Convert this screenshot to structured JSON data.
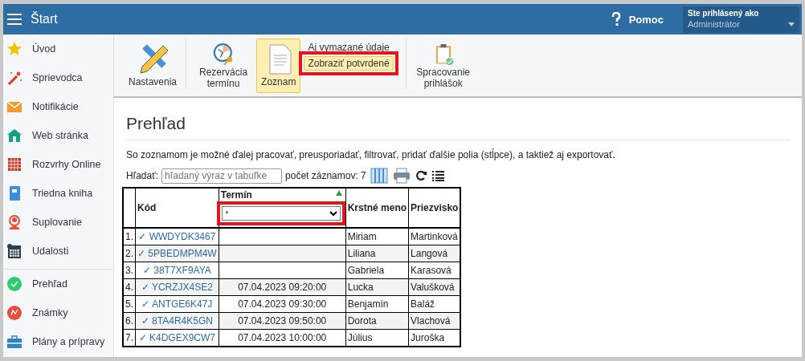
{
  "topbar": {
    "title": "Štart",
    "help": "Pomoc",
    "user_label": "Ste prihlásený ako",
    "user_name": "Administrátor"
  },
  "sidebar": {
    "groups": [
      [
        {
          "label": "Úvod"
        },
        {
          "label": "Sprievodca"
        },
        {
          "label": "Notifikácie"
        },
        {
          "label": "Web stránka"
        },
        {
          "label": "Rozvrhy Online"
        },
        {
          "label": "Triedna kniha"
        },
        {
          "label": "Suplovanie"
        },
        {
          "label": "Udalosti"
        }
      ],
      [
        {
          "label": "Prehľad"
        },
        {
          "label": "Známky"
        },
        {
          "label": "Plány a prípravy"
        }
      ]
    ]
  },
  "ribbon": {
    "items": [
      {
        "kind": "button",
        "label": "Nastavenia",
        "selected": false
      },
      {
        "kind": "button",
        "label": "Rezervácia termínu",
        "selected": false
      },
      {
        "kind": "button",
        "label": "Zoznam",
        "selected": true
      },
      {
        "kind": "options",
        "options": [
          {
            "label": "Aj vymazané údaje",
            "selected": false,
            "highlighted": false
          },
          {
            "label": "Zobraziť potvrdené",
            "selected": true,
            "highlighted": true
          }
        ]
      },
      {
        "kind": "button",
        "label": "Spracovanie prihlášok",
        "selected": false
      }
    ]
  },
  "page": {
    "title": "Prehľad",
    "description": "So zoznamom je možné ďalej pracovať, preusporiadať, filtrovať, pridať ďalšie polia (stĺpce), a taktiež aj exportovať.",
    "search_label": "Hľadať:",
    "search_placeholder": "hľadaný výraz v tabuľke",
    "count": "počet záznamov: 7"
  },
  "table": {
    "columns": [
      {
        "kind": "number"
      },
      {
        "kind": "plain",
        "label": "Kód"
      },
      {
        "kind": "filtered",
        "label": "Termín",
        "filter": "*",
        "highlighted": true
      },
      {
        "kind": "plain",
        "label": "Krstné meno"
      },
      {
        "kind": "plain",
        "label": "Priezvisko"
      }
    ],
    "rows": [
      [
        "1.",
        "✓ WWDYDK3467",
        "",
        "Miriam",
        "Martinková"
      ],
      [
        "2.",
        "✓ 5PBEDMPM4W",
        "",
        "Liliana",
        "Langová"
      ],
      [
        "3.",
        "✓ 38T7XF9AYA",
        "",
        "Gabriela",
        "Karasová"
      ],
      [
        "4.",
        "✓ YCRZJX4SE2",
        "07.04.2023 09:20:00",
        "Lucka",
        "Valušková"
      ],
      [
        "5.",
        "✓ ANTGE6K47J",
        "07.04.2023 09:30:00",
        "Benjamín",
        "Baláž"
      ],
      [
        "6.",
        "✓ 8TA4R4K5GN",
        "07.04.2023 09:50:00",
        "Dorota",
        "Vlachová"
      ],
      [
        "7.",
        "✓ K4DGEX9CW7",
        "07.04.2023 10:00:00",
        "Július",
        "Juroška"
      ]
    ]
  }
}
